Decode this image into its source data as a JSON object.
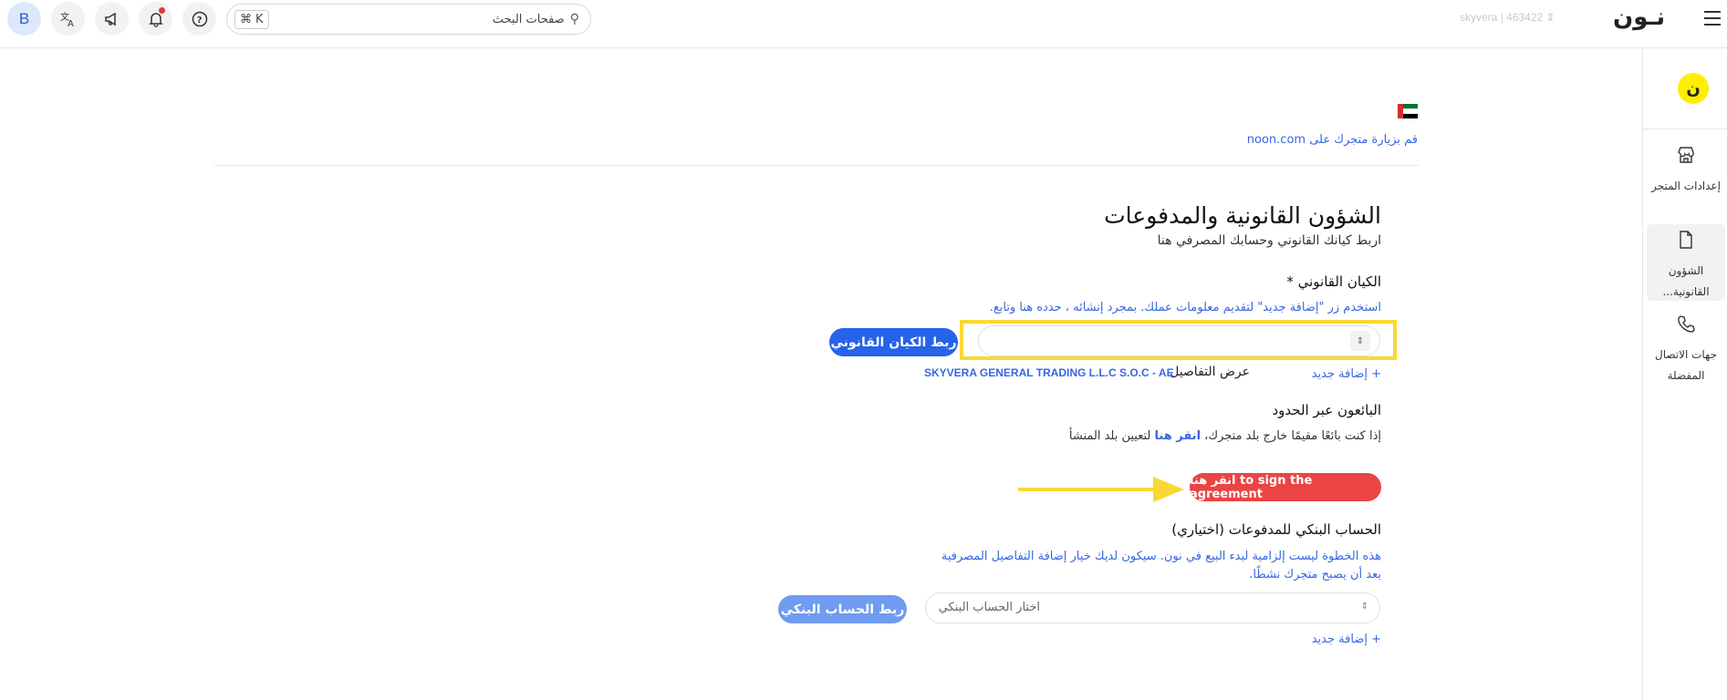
{
  "topbar": {
    "avatar_letter": "B",
    "search_placeholder": "صفحات البحث",
    "shortcut_symbol": "⌘",
    "shortcut_key": "K",
    "store_switcher": "skyvera | 463422",
    "logo": "نـون",
    "icons": [
      "translate-icon",
      "megaphone-icon",
      "bell-icon",
      "help-icon",
      "search-icon",
      "menu-icon"
    ]
  },
  "sidebar": {
    "logo_glyph": "ن",
    "items": [
      {
        "label": "إعدادات المتجر",
        "icon": "store-icon"
      },
      {
        "label": "الشؤون القانونية...",
        "icon": "document-icon",
        "active": true
      },
      {
        "label": "جهات الاتصال المفضلة",
        "icon": "phone-icon"
      }
    ]
  },
  "store": {
    "visit_link": "قم بزيارة متجرك على noon.com"
  },
  "main": {
    "title": "الشؤون القانونية والمدفوعات",
    "subtitle": "اربط كيانك القانوني وحسابك المصرفي هنا",
    "legal_entity": {
      "label": "الكيان القانوني *",
      "hint": "استخدم زر \"إضافة جديد\" لتقديم معلومات عملك. بمجرد إنشائه ، حدده هنا وتابع.",
      "select_value": "",
      "link_button": "ربط الكيان القانوني",
      "add_new": "+ إضافة جديد",
      "view_details": "عرض التفاصيل",
      "company_name": "SKYVERA GENERAL TRADING L.L.C S.O.C - AE"
    },
    "cross_border": {
      "label": "البائعون عبر الحدود",
      "text_before": "إذا كنت بائعًا مقيمًا خارج بلد متجرك، ",
      "click_here": "انقر هنا",
      "text_after": " لتعيين بلد المنشأ"
    },
    "sign_button": "انقر هنا to sign the agreement",
    "bank": {
      "label": "الحساب البنكي للمدفوعات (اختياري)",
      "hint_line1": "هذه الخطوة ليست إلزامية لبدء البيع في نون. سيكون لديك خيار إضافة التفاصيل المصرفية",
      "hint_line2": "بعد أن يصبح متجرك نشطًا.",
      "select_placeholder": "اختار الحساب البنكي",
      "link_button": "ربط الحساب البنكي",
      "add_new": "+ إضافة جديد"
    }
  },
  "colors": {
    "primary": "#2563eb",
    "link": "#3866df",
    "sign_button": "#ea4444",
    "highlight": "#f9d835",
    "noon_yellow": "#feee00"
  }
}
